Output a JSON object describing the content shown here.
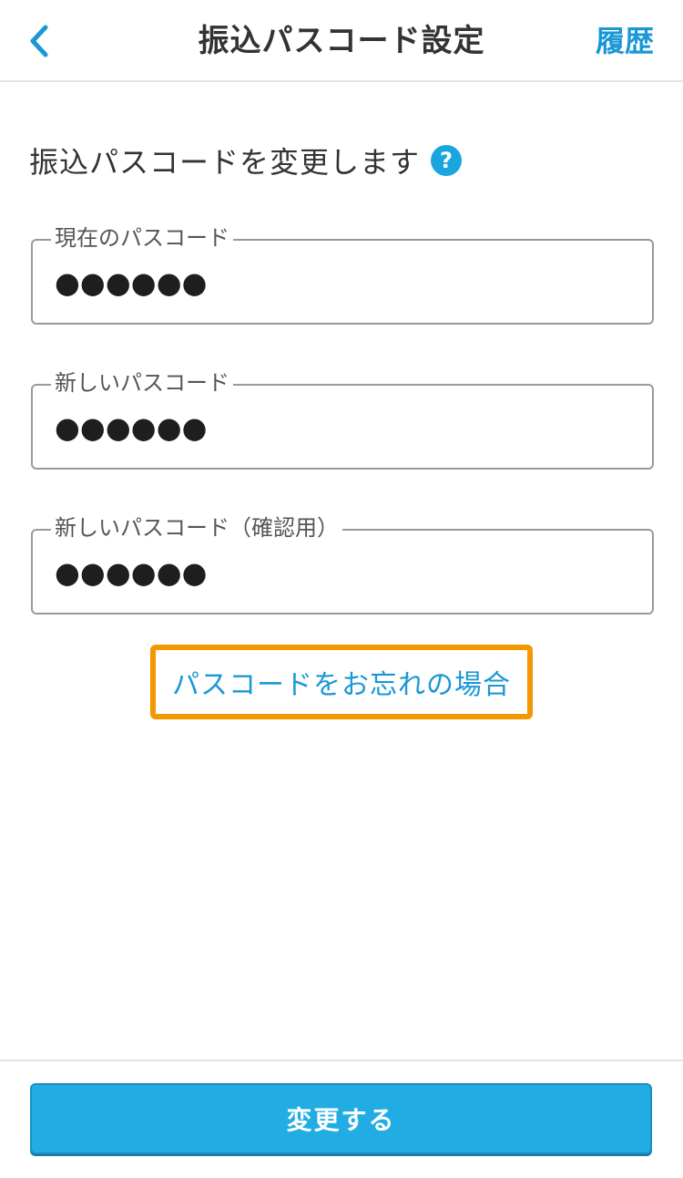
{
  "header": {
    "back_icon": "chevron-left-icon",
    "title": "振込パスコード設定",
    "history_label": "履歴",
    "accent_color": "#1a98d5"
  },
  "intro": {
    "text": "振込パスコードを変更します",
    "help_icon": "question-circle-icon",
    "help_glyph": "?"
  },
  "fields": [
    {
      "label": "現在のパスコード",
      "value": "●●●●●●"
    },
    {
      "label": "新しいパスコード",
      "value": "●●●●●●"
    },
    {
      "label": "新しいパスコード（確認用）",
      "value": "●●●●●●"
    }
  ],
  "forgot_link": {
    "label": "パスコードをお忘れの場合",
    "highlight_color": "#f39800"
  },
  "submit": {
    "label": "変更する",
    "color": "#21ade3"
  }
}
